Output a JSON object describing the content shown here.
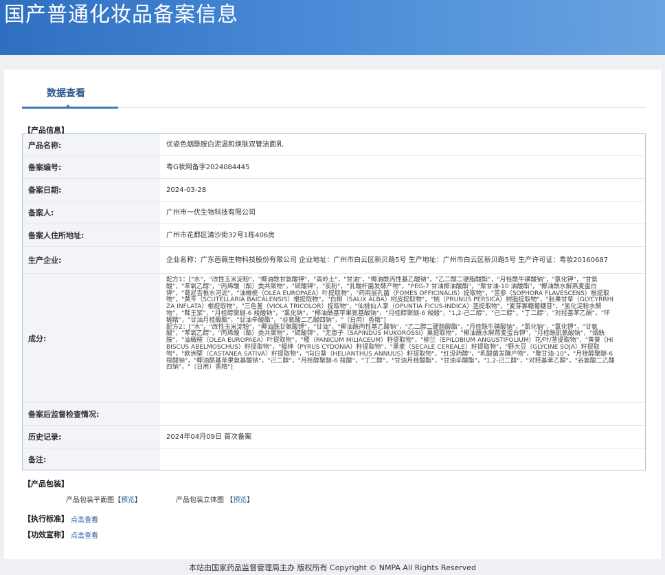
{
  "header": {
    "title": "国产普通化妆品备案信息"
  },
  "tab": {
    "label": "数据查看"
  },
  "product_info": {
    "section_label": "【产品信息】",
    "rows": [
      {
        "label": "产品名称:",
        "value": "优姿色烟酰胺白泥温和焕肤双管洁面乳"
      },
      {
        "label": "备案编号:",
        "value": "粤G妆网备字2024084445"
      },
      {
        "label": "备案日期:",
        "value": "2024-03-28"
      },
      {
        "label": "备案人:",
        "value": "广州市一优生物科技有限公司"
      },
      {
        "label": "备案人住所地址:",
        "value": "广州市花都区清沙街32号1栋406房"
      },
      {
        "label": "生产企业:",
        "value": "企业名称：广东芭薇生物科技股份有限公司 企业地址：广州市白云区新贝路5号 生产地址：广州市白云区新贝路5号 生产许可证：粤妆20160687"
      },
      {
        "label": "成分:",
        "value_lines": [
          "配方1：[\"水\"，\"改性玉米淀粉\"，\"椰油酰甘氨酸钾\"，\"高岭土\"，\"甘油\"，\"椰油酰丙性基乙酸钠\"，\"乙二醇二硬脂酸酯\"，\"月桂酰牛磺酸钠\"，\"氯化钾\"，\"甘氨酸\"，\"苯氧乙醇\"，\"丙烯酸（酯）类共聚物\"，\"硫酸钾\"，\"炭粉\"，\"乳酸杆菌发酵产物\"，\"PEG-7 甘油椰油酸酯\"，\"聚甘油-10 油酸酯\"，\"椰油酰水解燕麦蛋白钾\"，\"葛尼吉根水河泥\"，\"油橄榄（OLEA EUROPAEA）叶提取物\"，\"药用层孔菌（FOMES OFFICINALIS）提取物\"，\"苦参（SOPHORA FLAVESCENS）根提取物\"，\"黄芩（SCUTELLARIA BAICALENSIS）根提取物\"，\"白柳（SALIX ALBA）树皮提取物\"，\"桃（PRUNUS PERSICA）树脂提取物\"，\"胀果甘草（GLYCYRRHIZA INFLATA）根提取物\"，\"三色堇（VIOLA TRICOLOR）提取物\"，\"仙桃仙人掌（OPUNTIA FICUS-INDICA）茎提取物\"，\"麦芽寡糖葡糖苷\"，\"氢化淀粉水解物\"，\"鞣王浆\"，\"月桂醇聚醚-6 羧酸钠\"，\"氯化钠\"，\"椰油酰基苹果氨基酸钠\"，\"月桂醇聚醚-6 羧酸\"，\"1,2-己二醇\"，\"己二醇\"，\"丁二醇\"，\"对羟基苯乙酮\"，\"环糊精\"，\"甘油月桂酸酯\"，\"甘油辛酸酯\"，\"谷氨酸二乙酸四钠\"，\"（日用）香精\"]",
          "配方2：[\"水\"，\"改性玉米淀粉\"，\"椰油酰甘氨酸钾\"，\"甘油\"，\"椰油酰丙性基乙酸钠\"，\"乙二醇二硬脂酸酯\"，\"月桂酰牛磺酸钠\"，\"氯化钠\"，\"氯化钾\"，\"甘氨酸\"，\"苯氧乙醇\"，\"丙烯酸（酯）类共聚物\"，\"硫酸钾\"，\"无患子（SAPINDUS MUKOROSSI）果提取物\"，\"椰油酰水解燕麦蛋白钾\"，\"月桂酰肌氨酸钠\"，\"烟酰胺\"，\"油橄榄（OLEA EUROPAEA）叶提取物\"，\"稷（PANICUM MILIACEUM）籽提取物\"，\"柳兰（EPILOBIUM ANGUSTIFOLIUM）花/叶/茎提取物\"，\"黄葵（HIBISCUS ABELMOSCHUS）籽提取物\"，\"榅桲（PYRUS CYDONIA）籽提取物\"，\"黑麦（SECALE CEREALE）籽提取物\"，\"野大豆（GLYCINE SOJA）籽提取物\"，\"欧洲栗（CASTANEA SATIVA）籽提取物\"，\"向日葵（HELIANTHUS ANNUUS）籽提取物\"，\"红没药醇\"，\"乳酸菌发酵产物\"，\"聚甘油-10\"，\"月桂醇聚醚-6 羧酸钠\"，\"椰油酰基苹果氨基酸钠\"，\"己二醇\"，\"月桂醇聚醚-6 羧酸\"，\"丁二醇\"，\"甘油月桂酸酯\"，\"甘油辛酸酯\"，\"1,2-己二醇\"，\"对羟基苯乙酮\"，\"谷氨酸二乙酸四钠\"，\"（日用）香精\"]"
        ]
      },
      {
        "label": "备案后监督检查情况:",
        "value": ""
      },
      {
        "label": "历史记录:",
        "value": "2024年04月09日 首次备案"
      },
      {
        "label": "备注:",
        "value": ""
      }
    ]
  },
  "packaging": {
    "section_label": "【产品包装】",
    "flat_label": "产品包装平面图",
    "flat_link": "预览",
    "solid_label": "产品包装立体图",
    "solid_link": "预览"
  },
  "standard": {
    "label": "【执行标准】",
    "link": "点击查看"
  },
  "efficacy": {
    "label": "【功效宣称】",
    "link": "点击查看"
  },
  "footer": {
    "text": "本站由国家药品监督管理局主办 版权所有 Copyright © NMPA All Rights Reserved"
  }
}
